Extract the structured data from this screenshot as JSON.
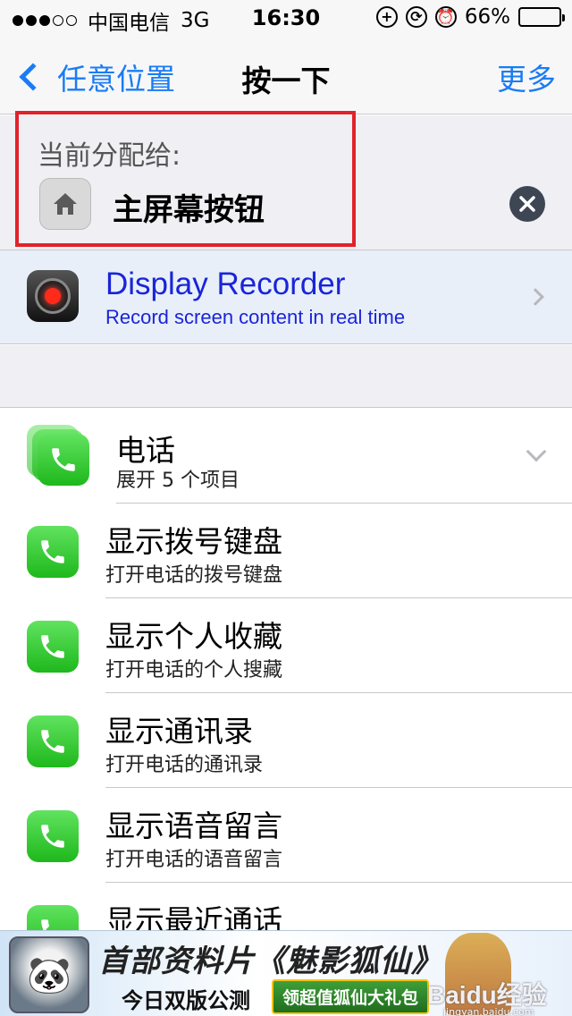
{
  "status_bar": {
    "carrier": "中国电信",
    "network": "3G",
    "time": "16:30",
    "battery_percent": "66%",
    "battery_level": 0.66
  },
  "nav": {
    "back_label": "任意位置",
    "title": "按一下",
    "more_label": "更多"
  },
  "assigned": {
    "label": "当前分配给:",
    "name": "主屏幕按钮",
    "icon": "home-icon"
  },
  "featured": {
    "title": "Display Recorder",
    "subtitle": "Record screen content in real time",
    "icon": "record-icon"
  },
  "group": {
    "title": "电话",
    "subtitle": "展开 5 个项目",
    "icon": "phone-icon"
  },
  "items": [
    {
      "title": "显示拨号键盘",
      "subtitle": "打开电话的拨号键盘"
    },
    {
      "title": "显示个人收藏",
      "subtitle": "打开电话的个人搜藏"
    },
    {
      "title": "显示通讯录",
      "subtitle": "打开电话的通讯录"
    },
    {
      "title": "显示语音留言",
      "subtitle": "打开电话的语音留言"
    },
    {
      "title": "显示最近通话",
      "subtitle": ""
    }
  ],
  "ad": {
    "headline": "首部资料片《魅影狐仙》",
    "line2": "今日双版公测",
    "button": "领超值狐仙大礼包"
  },
  "watermark": {
    "text": "Baidu经验",
    "url": "jingyan.baidu.com"
  },
  "colors": {
    "accent": "#1a7cf5",
    "highlight_box": "#e1222b",
    "featured_text": "#1a24d9",
    "phone_green": "#1eb81c"
  }
}
